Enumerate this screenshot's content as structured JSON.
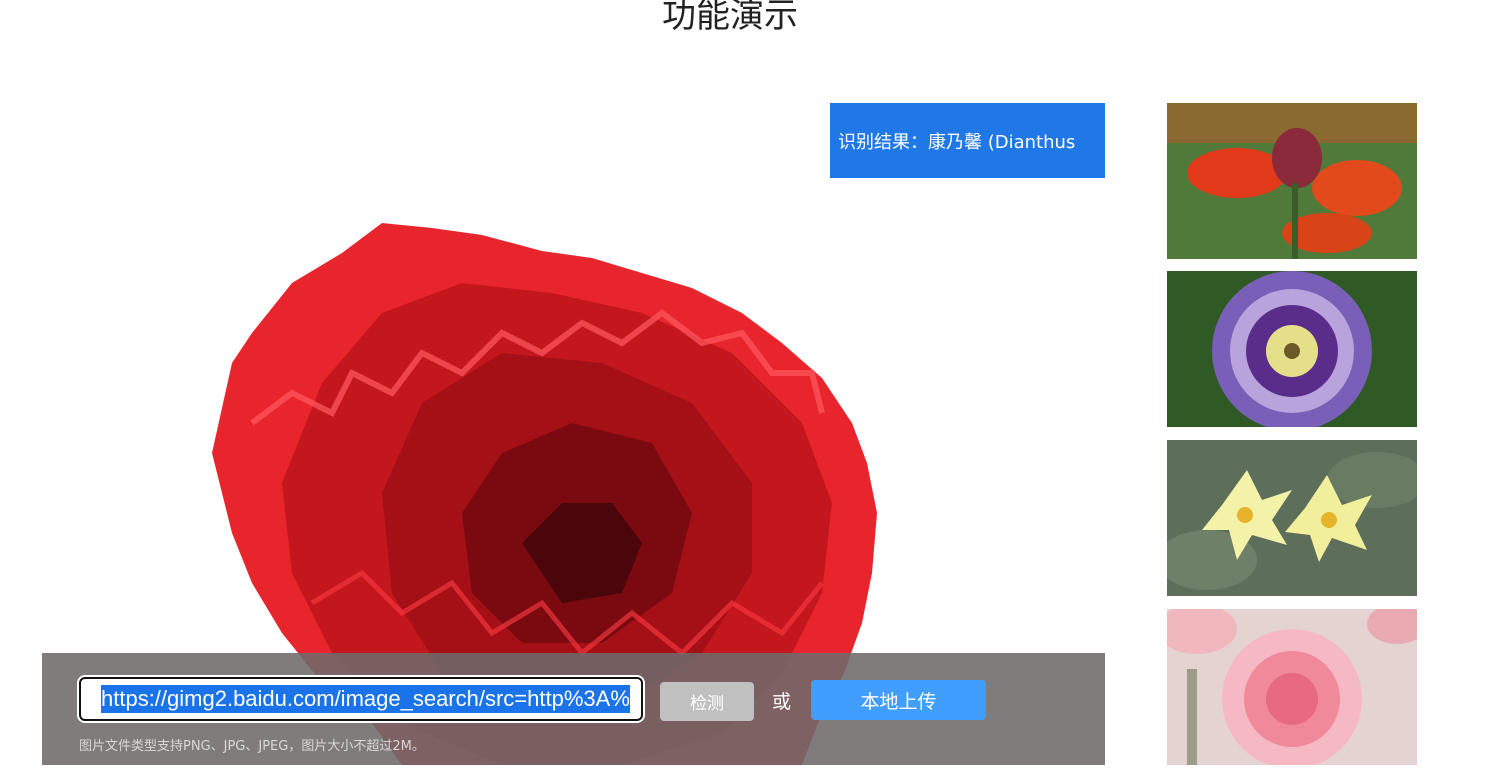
{
  "page": {
    "title": "功能演示"
  },
  "result": {
    "text": "识别结果：康乃馨 (Dianthus"
  },
  "controls": {
    "url_value": "https://gimg2.baidu.com/image_search/src=http%3A%",
    "detect_label": "检测",
    "or_label": "或",
    "upload_label": "本地上传",
    "hint": "图片文件类型支持PNG、JPG、JPEG，图片大小不超过2M。"
  },
  "samples": [
    {
      "icon": "red-wallflower-photo"
    },
    {
      "icon": "passion-flower-photo"
    },
    {
      "icon": "yellow-water-lily-photo"
    },
    {
      "icon": "pink-carnation-photo"
    }
  ],
  "colors": {
    "accent": "#1f78e6",
    "upload": "#409eff",
    "detect": "#c0c0c0"
  }
}
